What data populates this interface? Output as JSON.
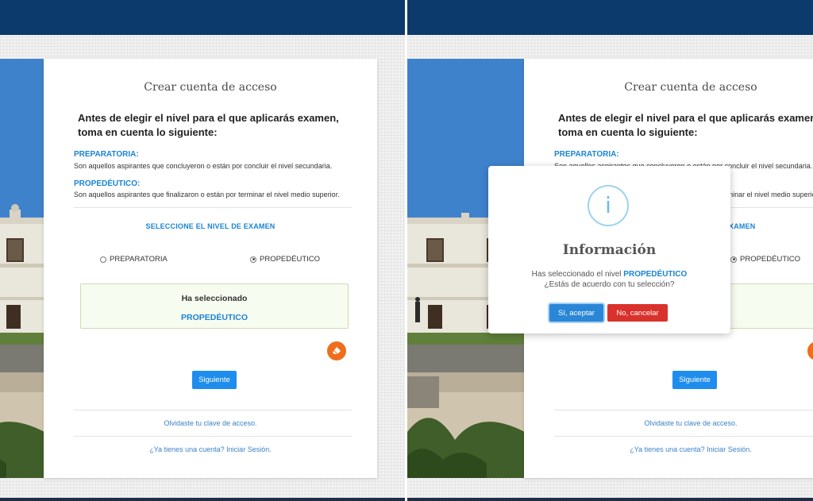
{
  "form": {
    "title": "Crear cuenta de acceso",
    "intro": "Antes de elegir el nivel para el que aplicarás examen, toma en cuenta lo siguiente:",
    "prep_title": "PREPARATORIA:",
    "prep_text": "Son aquellos aspirantes que concluyeron o están por concluir el nivel secundaria.",
    "prop_title": "PROPEDÉUTICO:",
    "prop_text": "Son aquellos aspirantes que finalizaron o están por terminar el nivel medio superior.",
    "select_label": "SELECCIONE EL NIVEL DE EXAMEN",
    "options": [
      {
        "label": "PREPARATORIA",
        "checked": false
      },
      {
        "label": "PROPEDÉUTICO",
        "checked": true
      }
    ],
    "selected_label": "Ha seleccionado",
    "selected_value": "PROPEDÉUTICO",
    "next_button": "Siguiente",
    "forgot_link": "Olvidaste tu clave de acceso.",
    "login_link": "¿Ya tienes una cuenta? Iniciar Sesión."
  },
  "modal": {
    "icon": "info-icon",
    "title": "Información",
    "text_prefix": "Has seleccionado el nivel",
    "level": "PROPEDÉUTICO",
    "question": "¿Estás de acuerdo con tu selección?",
    "accept": "Sí, aceptar",
    "cancel": "No, cancelar"
  },
  "colors": {
    "header": "#0d3a6c",
    "accent_blue": "#1a84d4",
    "button_blue": "#1f8ded",
    "cancel_red": "#d9322c",
    "fab_orange": "#ee6e1d"
  }
}
